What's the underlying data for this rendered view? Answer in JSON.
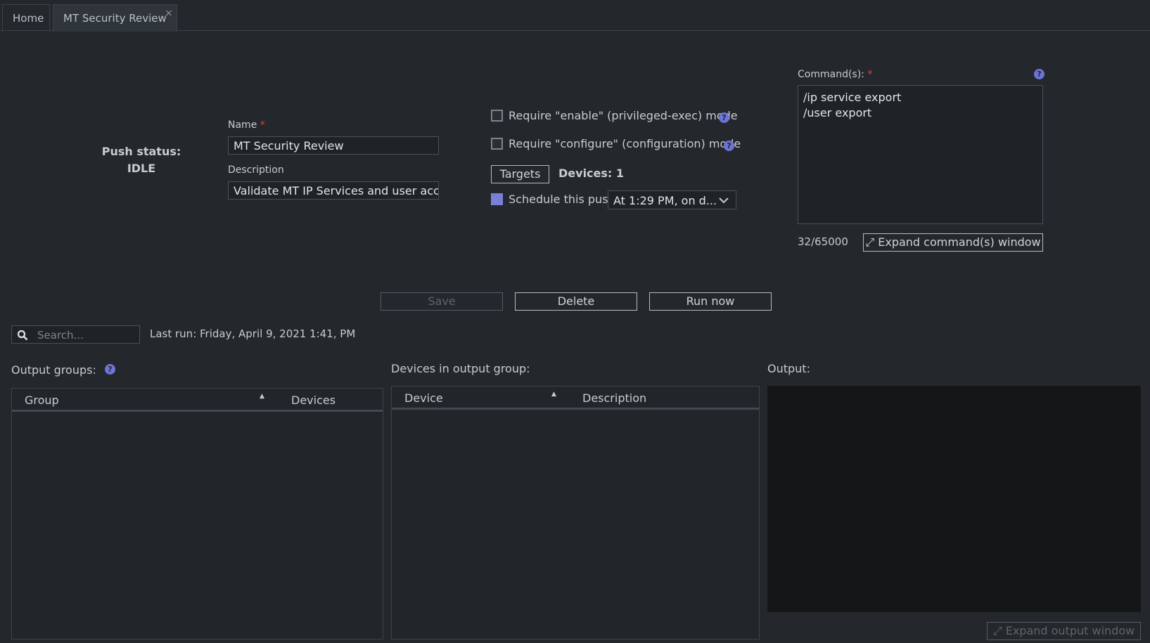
{
  "tabs": [
    {
      "label": "Home"
    },
    {
      "label": "MT Security Review",
      "close": "×"
    }
  ],
  "push_status": {
    "label": "Push status:",
    "value": "IDLE"
  },
  "form": {
    "name_label": "Name",
    "name_value": "MT Security Review",
    "description_label": "Description",
    "description_value": "Validate MT IP Services and user accou",
    "required_mark": "*"
  },
  "options": {
    "enable_label": "Require \"enable\" (privileged-exec) mode",
    "enable_checked": false,
    "configure_label": "Require \"configure\" (configuration) mode",
    "configure_checked": false,
    "targets_label": "Targets",
    "devices_count": "Devices: 1",
    "schedule_label": "Schedule this push",
    "schedule_checked": true,
    "schedule_value": "At 1:29 PM, on d..."
  },
  "commands": {
    "label": "Command(s):",
    "lines": [
      "/ip service export",
      "/user export"
    ],
    "count": "32/65000",
    "expand_label": "Expand command(s) window"
  },
  "actions": {
    "save": "Save",
    "delete": "Delete",
    "run_now": "Run now"
  },
  "search": {
    "placeholder": "Search..."
  },
  "last_run": "Last run: Friday, April 9, 2021 1:41, PM",
  "output_groups": {
    "label": "Output groups:",
    "columns": [
      "Group",
      "Devices"
    ]
  },
  "devices_group": {
    "label": "Devices in output group:",
    "columns": [
      "Device",
      "Description"
    ]
  },
  "output": {
    "label": "Output:",
    "expand_label": "Expand output window"
  },
  "help_glyph": "?"
}
